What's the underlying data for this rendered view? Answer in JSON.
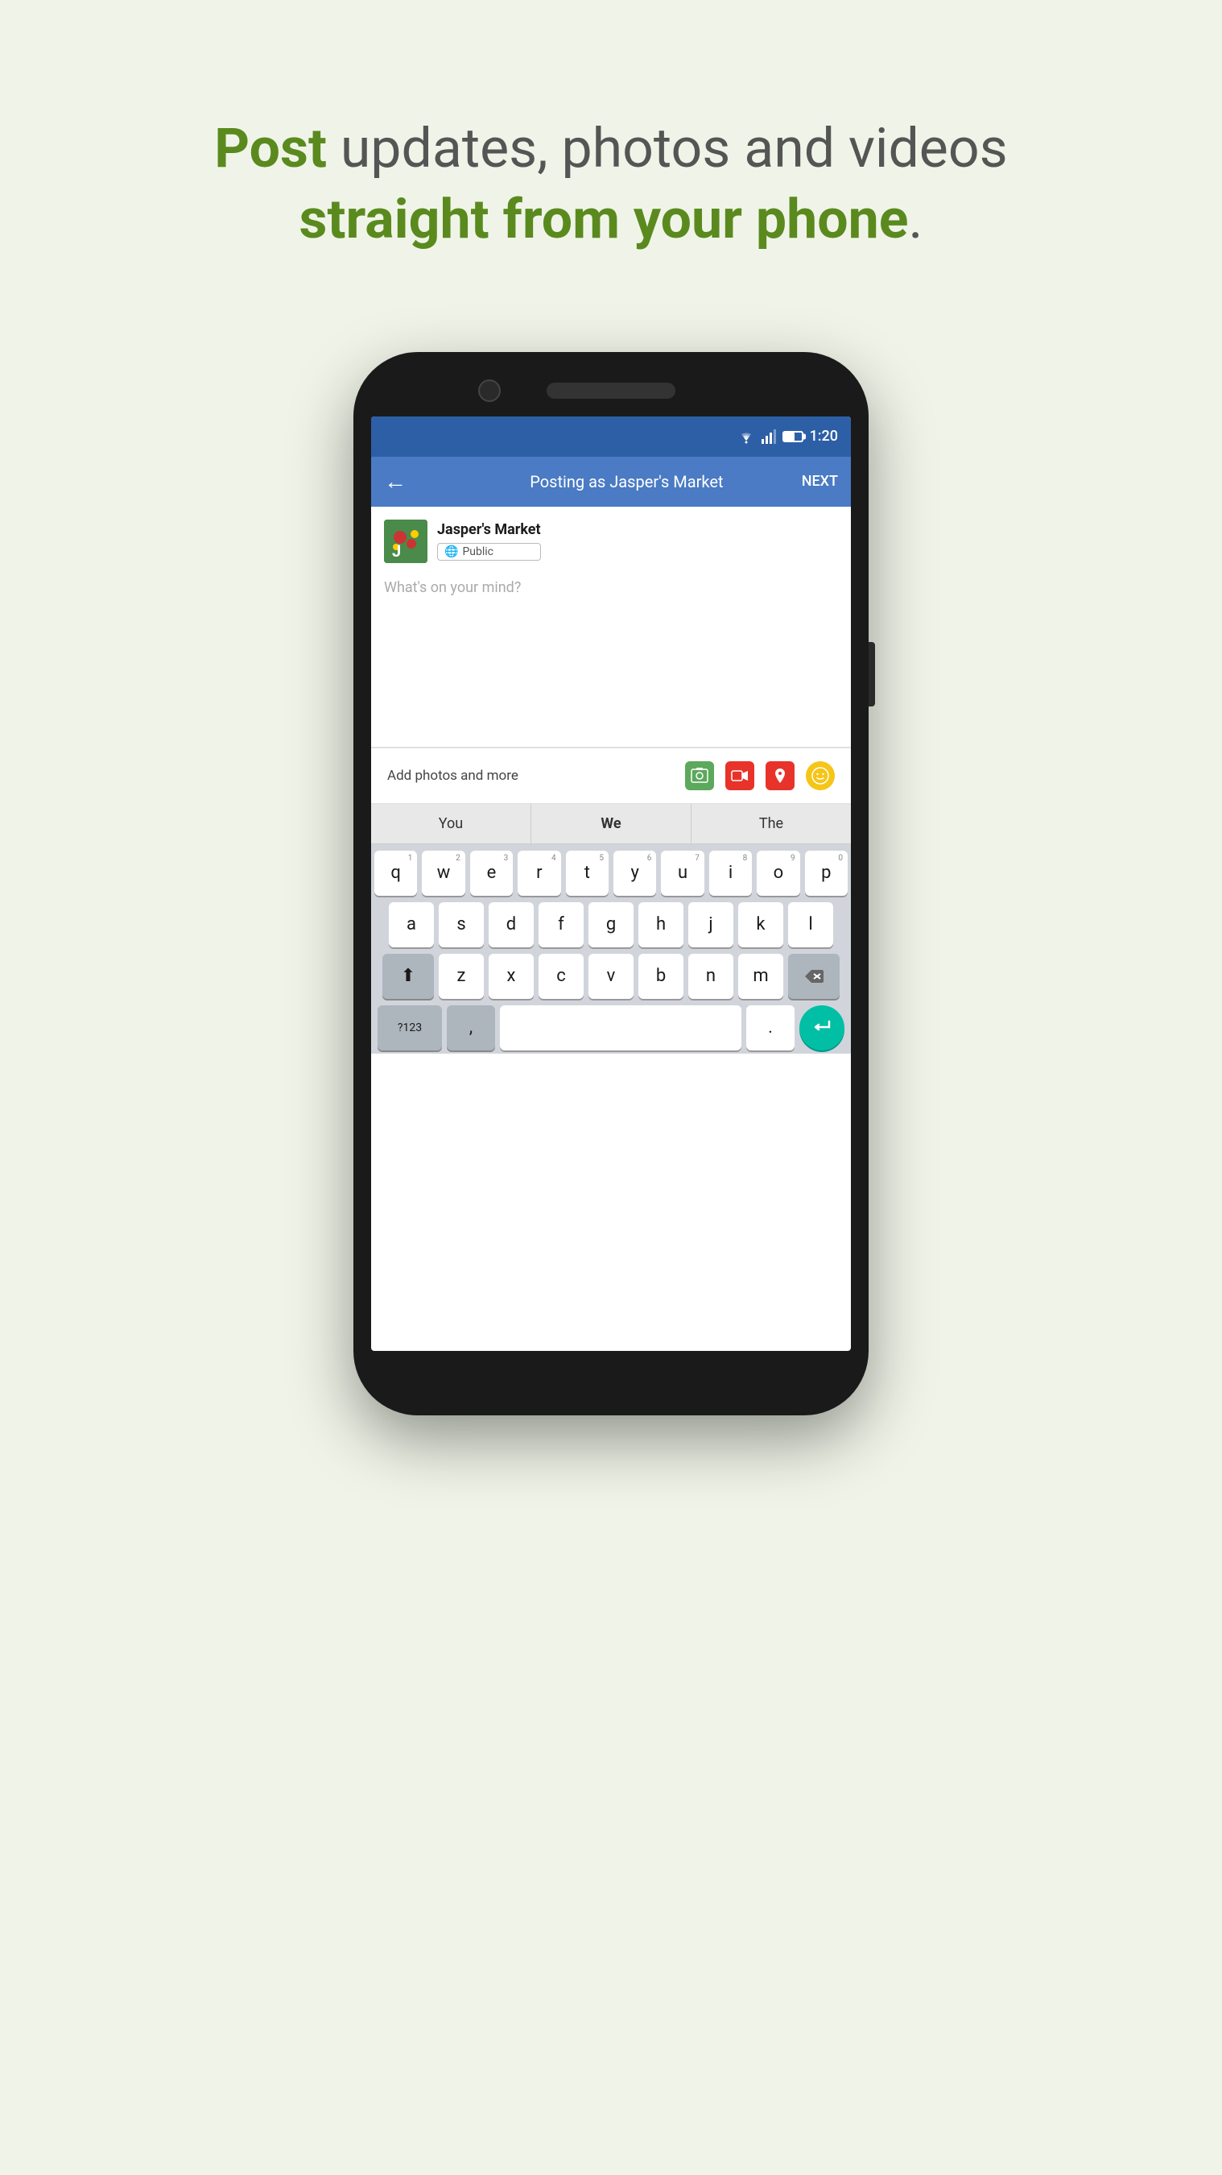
{
  "headline": {
    "part1_bold": "Post",
    "part1_rest": " updates, photos and videos",
    "line2": "straight from your phone",
    "dot": "."
  },
  "status_bar": {
    "time": "1:20"
  },
  "app_bar": {
    "title": "Posting as Jasper's Market",
    "back_label": "←",
    "next_label": "NEXT"
  },
  "poster": {
    "name": "Jasper's Market",
    "privacy": "Public"
  },
  "post": {
    "placeholder": "What's on your mind?"
  },
  "add_photos": {
    "label": "Add photos and more"
  },
  "suggestions": [
    {
      "text": "You",
      "bold": false
    },
    {
      "text": "We",
      "bold": true
    },
    {
      "text": "The",
      "bold": false
    }
  ],
  "keyboard": {
    "row1": [
      "q",
      "w",
      "e",
      "r",
      "t",
      "y",
      "u",
      "i",
      "o",
      "p"
    ],
    "row1_nums": [
      "1",
      "2",
      "3",
      "4",
      "5",
      "6",
      "7",
      "8",
      "9",
      "0"
    ],
    "row2": [
      "a",
      "s",
      "d",
      "f",
      "g",
      "h",
      "j",
      "k",
      "l"
    ],
    "row3": [
      "z",
      "x",
      "c",
      "v",
      "b",
      "n",
      "m"
    ],
    "misc_key_123": "?123",
    "misc_comma": ",",
    "misc_period": ".",
    "shift_icon": "⬆",
    "delete_icon": "⌫",
    "enter_icon": "↵"
  }
}
